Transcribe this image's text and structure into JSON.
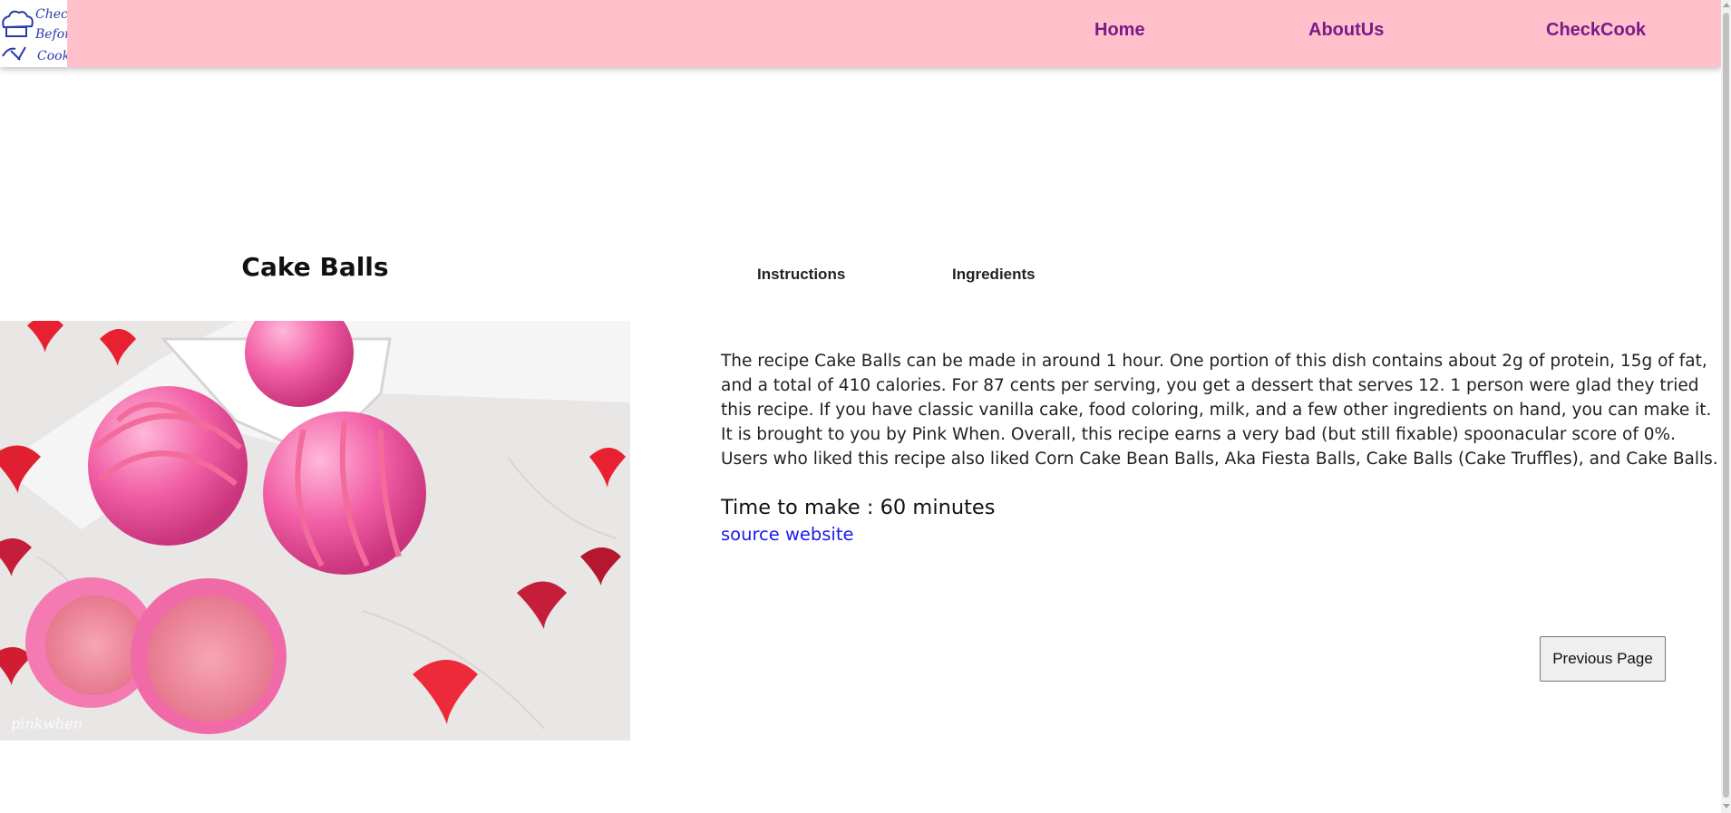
{
  "header": {
    "logo_text": [
      "Check",
      "Before",
      "Cook"
    ],
    "nav": [
      {
        "label": "Home"
      },
      {
        "label": "AboutUs"
      },
      {
        "label": "CheckCook"
      }
    ],
    "background_color": "#ffc0cb",
    "link_color": "#7a1a86"
  },
  "recipe": {
    "title": "Cake Balls",
    "image_watermark": "pinkwhen",
    "tabs": [
      {
        "label": "Instructions"
      },
      {
        "label": "Ingredients"
      }
    ],
    "summary": "The recipe Cake Balls can be made in around 1 hour. One portion of this dish contains about 2g of protein, 15g of fat, and a total of 410 calories. For 87 cents per serving, you get a dessert that serves 12. 1 person were glad they tried this recipe. If you have classic vanilla cake, food coloring, milk, and a few other ingredients on hand, you can make it. It is brought to you by Pink When. Overall, this recipe earns a very bad (but still fixable) spoonacular score of 0%. Users who liked this recipe also liked Corn Cake Bean Balls, Aka Fiesta Balls, Cake Balls (Cake Truffles), and Cake Balls.",
    "time_to_make": "Time to make : 60 minutes",
    "source_link": "source website",
    "previous_button": "Previous Page"
  }
}
